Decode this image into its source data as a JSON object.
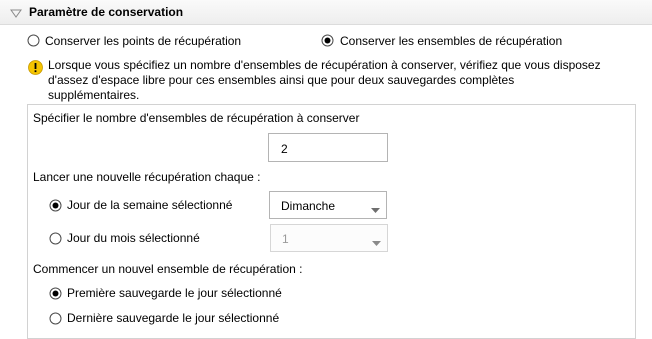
{
  "header": {
    "title": "Paramètre de conservation"
  },
  "retention_mode": {
    "option_points": "Conserver les points de récupération",
    "option_sets": "Conserver les ensembles de récupération",
    "selected": "sets"
  },
  "warning": {
    "text": "Lorsque vous spécifiez un nombre d'ensembles de récupération à conserver, vérifiez que vous disposez d'assez d'espace libre pour ces ensembles ainsi que pour deux sauvegardes complètes supplémentaires."
  },
  "sets_count": {
    "label": "Spécifier le nombre d'ensembles de récupération à conserver",
    "value": "2"
  },
  "new_recovery": {
    "label": "Lancer une nouvelle récupération chaque :",
    "option_weekday": "Jour de la semaine sélectionné",
    "option_monthday": "Jour du mois sélectionné",
    "weekday_value": "Dimanche",
    "monthday_value": "1",
    "selected": "weekday"
  },
  "new_set": {
    "label": "Commencer un nouvel ensemble de récupération :",
    "option_first": "Première sauvegarde le jour sélectionné",
    "option_last": "Dernière sauvegarde le jour sélectionné",
    "selected": "first"
  },
  "colors": {
    "warning": "#f5c400",
    "border": "#d2d2d2"
  }
}
